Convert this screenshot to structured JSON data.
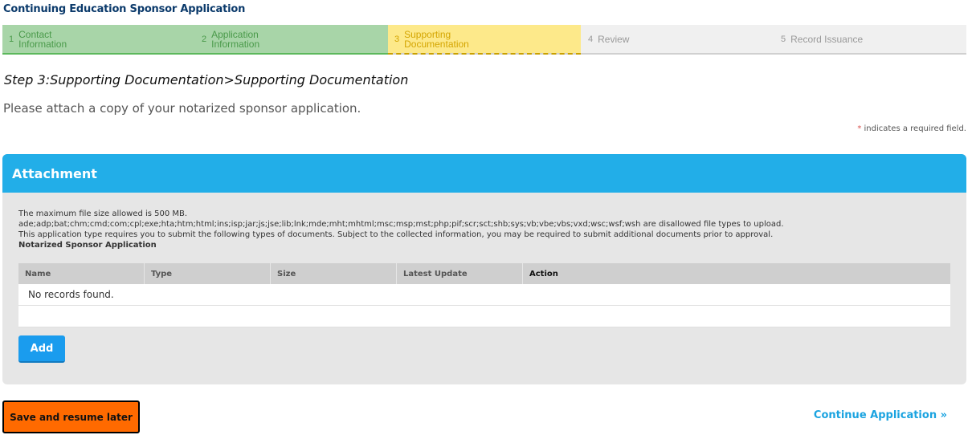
{
  "app": {
    "title": "Continuing Education Sponsor Application"
  },
  "steps": [
    {
      "num": "1",
      "label": "Contact Information",
      "state": "done"
    },
    {
      "num": "2",
      "label": "Application Information",
      "state": "done"
    },
    {
      "num": "3",
      "label": "Supporting Documentation",
      "state": "current"
    },
    {
      "num": "4",
      "label": "Review",
      "state": "todo"
    },
    {
      "num": "5",
      "label": "Record Issuance",
      "state": "todo"
    }
  ],
  "page": {
    "heading": "Step 3:Supporting Documentation>Supporting Documentation",
    "instructions": "Please attach a copy of your notarized sponsor application.",
    "required_star": "*",
    "required_note": "indicates a required field."
  },
  "attachment": {
    "title": "Attachment",
    "max_size": "The maximum file size allowed is 500 MB.",
    "disallowed": "ade;adp;bat;chm;cmd;com;cpl;exe;hta;htm;html;ins;isp;jar;js;jse;lib;lnk;mde;mht;mhtml;msc;msp;mst;php;pif;scr;sct;shb;sys;vb;vbe;vbs;vxd;wsc;wsf;wsh are disallowed file types to upload.",
    "requirement": "This application type requires you to submit the following types of documents. Subject to the collected information, you may be required to submit additional documents prior to approval.",
    "doc_type": "Notarized Sponsor Application",
    "columns": {
      "name": "Name",
      "type": "Type",
      "size": "Size",
      "latest_update": "Latest Update",
      "action": "Action"
    },
    "empty_message": "No records found.",
    "add_label": "Add"
  },
  "footer": {
    "save_label": "Save and resume later",
    "continue_label": "Continue Application »"
  },
  "colors": {
    "header_blue": "#22aee8",
    "step_done": "#a8d5a8",
    "step_current": "#fde98a",
    "save_orange": "#ff6a00",
    "link_blue": "#1aa3e0"
  }
}
